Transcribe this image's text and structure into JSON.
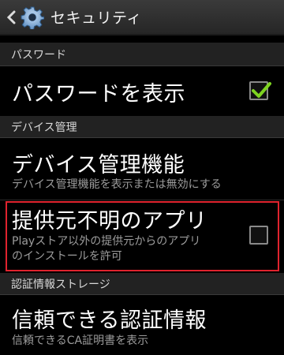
{
  "action_bar": {
    "title": "セキュリティ"
  },
  "sections": {
    "password": {
      "header": "パスワード"
    },
    "device_admin": {
      "header": "デバイス管理"
    },
    "credential_storage": {
      "header": "認証情報ストレージ"
    }
  },
  "items": {
    "show_password": {
      "title": "パスワードを表示",
      "checked": true
    },
    "device_admins": {
      "title": "デバイス管理機能",
      "summary": "デバイス管理機能を表示または無効にする"
    },
    "unknown_sources": {
      "title": "提供元不明のアプリ",
      "summary_line1": "Playストア以外の提供元からのアプリ",
      "summary_line2": "のインストールを許可",
      "checked": false
    },
    "trusted_credentials": {
      "title": "信頼できる認証情報",
      "summary": "信頼できるCA証明書を表示"
    }
  },
  "colors": {
    "check_green": "#7ed321",
    "highlight_red": "#e0232e"
  }
}
